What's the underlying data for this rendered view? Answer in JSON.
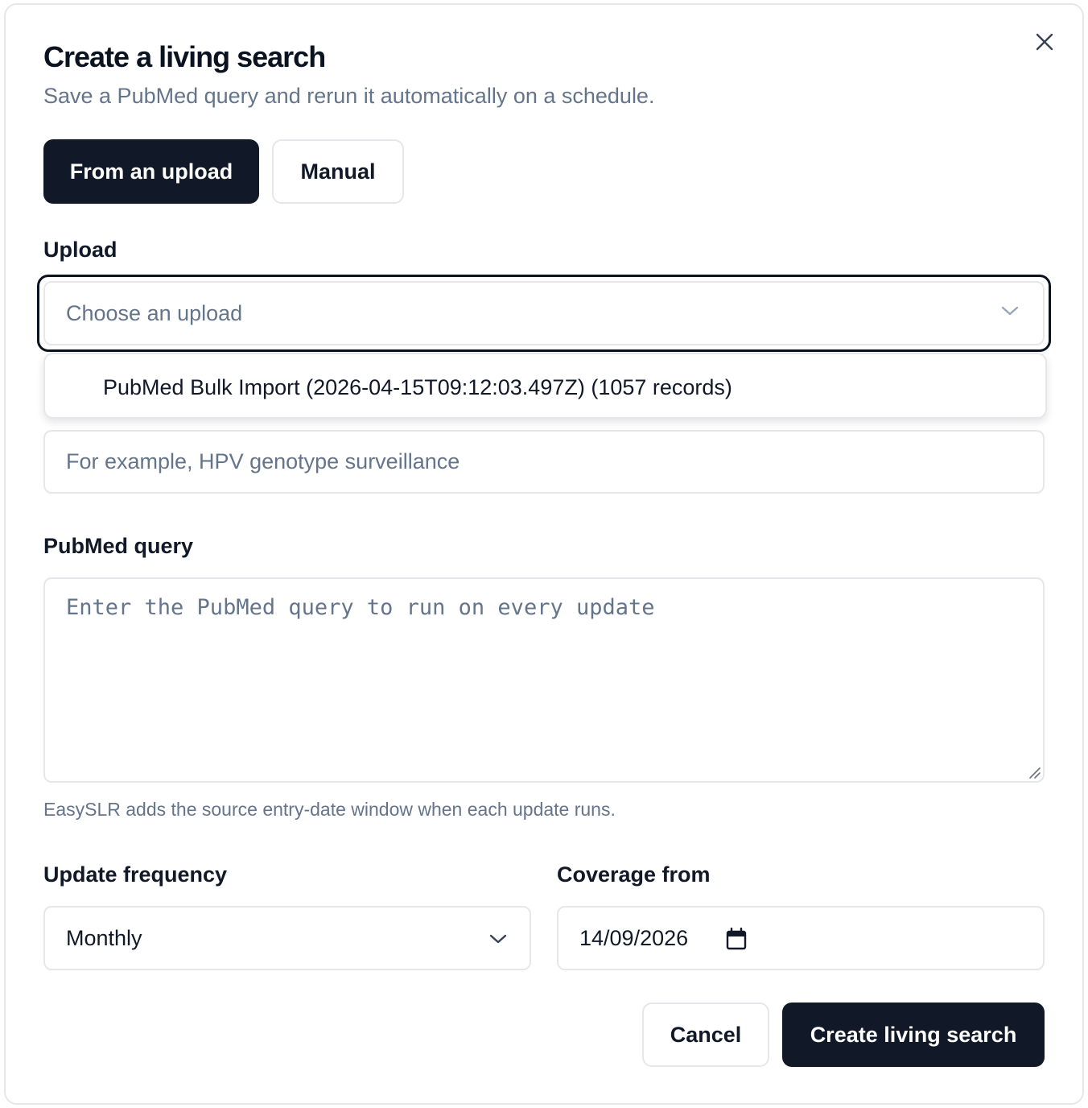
{
  "dialog": {
    "title": "Create a living search",
    "subtitle": "Save a PubMed query and rerun it automatically on a schedule."
  },
  "mode_tabs": [
    {
      "label": "From an upload",
      "active": true
    },
    {
      "label": "Manual",
      "active": false
    }
  ],
  "upload": {
    "label": "Upload",
    "placeholder": "Choose an upload",
    "options": [
      "PubMed Bulk Import (2026-04-15T09:12:03.497Z) (1057 records)"
    ]
  },
  "name_field": {
    "placeholder": "For example, HPV genotype surveillance"
  },
  "query": {
    "label": "PubMed query",
    "placeholder": "Enter the PubMed query to run on every update",
    "hint": "EasySLR adds the source entry-date window when each update runs."
  },
  "frequency": {
    "label": "Update frequency",
    "value": "Monthly"
  },
  "coverage": {
    "label": "Coverage from",
    "value": "14/09/2026"
  },
  "actions": {
    "cancel": "Cancel",
    "create": "Create living search"
  },
  "colors": {
    "primary": "#111827",
    "muted": "#64748b",
    "border": "#e5e7eb"
  }
}
